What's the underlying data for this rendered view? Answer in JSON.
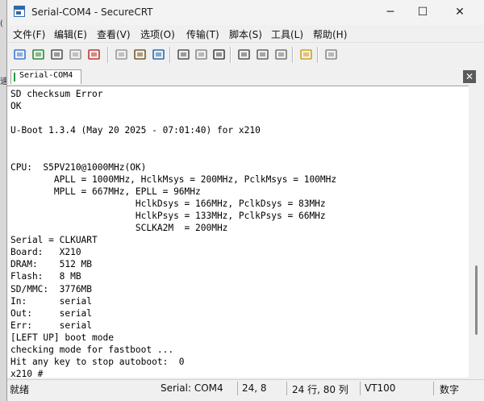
{
  "window": {
    "title": "Serial-COM4 - SecureCRT",
    "minimize": "─",
    "maximize": "☐",
    "close": "✕"
  },
  "menu": [
    "文件(F)",
    "编辑(E)",
    "查看(V)",
    "选项(O)",
    "传输(T)",
    "脚本(S)",
    "工具(L)",
    "帮助(H)"
  ],
  "toolbar": [
    {
      "name": "connect-icon",
      "color": "#3a7bd5"
    },
    {
      "name": "quick-connect-icon",
      "color": "#2b8a3e"
    },
    {
      "name": "connect-tab-icon",
      "color": "#555555"
    },
    {
      "name": "reconnect-icon",
      "color": "#9a9a9a"
    },
    {
      "name": "disconnect-icon",
      "color": "#c0392b"
    },
    {
      "name": "copy-icon",
      "color": "#9a9a9a"
    },
    {
      "name": "paste-icon",
      "color": "#7a5a2a"
    },
    {
      "name": "find-icon",
      "color": "#2b6cb0"
    },
    {
      "name": "print-setup-icon",
      "color": "#555555"
    },
    {
      "name": "print-screen-icon",
      "color": "#8a8a8a"
    },
    {
      "name": "print-icon",
      "color": "#444444"
    },
    {
      "name": "session-options-icon",
      "color": "#555555"
    },
    {
      "name": "global-options-icon",
      "color": "#666666"
    },
    {
      "name": "keymap-icon",
      "color": "#777777"
    },
    {
      "name": "help-icon",
      "color": "#d4a017"
    },
    {
      "name": "sftp-icon",
      "color": "#8a8a8a"
    }
  ],
  "tab": {
    "label": "Serial-COM4",
    "close": "✕"
  },
  "left_edge": [
    "(",
    "速"
  ],
  "terminal": {
    "lines": [
      "SD checksum Error",
      "OK",
      "",
      "U-Boot 1.3.4 (May 20 2025 - 07:01:40) for x210",
      "",
      "",
      "CPU:  S5PV210@1000MHz(OK)",
      "        APLL = 1000MHz, HclkMsys = 200MHz, PclkMsys = 100MHz",
      "        MPLL = 667MHz, EPLL = 96MHz",
      "                       HclkDsys = 166MHz, PclkDsys = 83MHz",
      "                       HclkPsys = 133MHz, PclkPsys = 66MHz",
      "                       SCLKA2M  = 200MHz",
      "Serial = CLKUART",
      "Board:   X210",
      "DRAM:    512 MB",
      "Flash:   8 MB",
      "SD/MMC:  3776MB",
      "In:      serial",
      "Out:     serial",
      "Err:     serial",
      "[LEFT UP] boot mode",
      "checking mode for fastboot ...",
      "Hit any key to stop autoboot:  0",
      "x210 # "
    ],
    "scroll_position": 0.85
  },
  "status": {
    "ready": "就绪",
    "port": "Serial: COM4",
    "cursor": "24,  8",
    "rows_cols": "24 行, 80 列",
    "emulation": "VT100",
    "num": "数字"
  }
}
